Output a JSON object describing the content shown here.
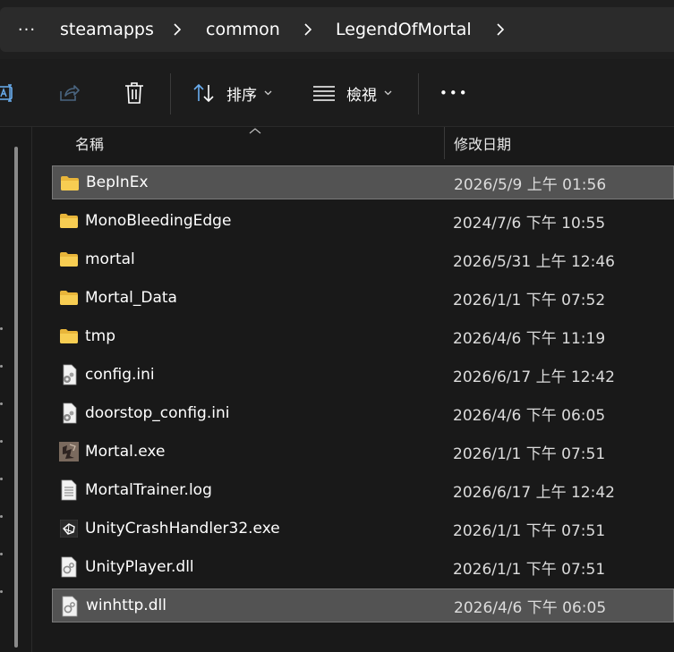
{
  "address": {
    "more_glyph": "···",
    "crumbs": [
      "steamapps",
      "common",
      "LegendOfMortal"
    ]
  },
  "toolbar": {
    "rename_icon": "rename-icon",
    "share_icon": "share-icon",
    "delete_icon": "trash-icon",
    "sort_label": "排序",
    "view_label": "檢視",
    "more_glyph": "•••"
  },
  "columns": {
    "name": "名稱",
    "date": "修改日期"
  },
  "files": [
    {
      "name": "BepInEx",
      "date": "2026/5/9 上午 01:56",
      "type": "folder",
      "selected": true
    },
    {
      "name": "MonoBleedingEdge",
      "date": "2024/7/6 下午 10:55",
      "type": "folder",
      "selected": false
    },
    {
      "name": "mortal",
      "date": "2026/5/31 上午 12:46",
      "type": "folder",
      "selected": false
    },
    {
      "name": "Mortal_Data",
      "date": "2026/1/1 下午 07:52",
      "type": "folder",
      "selected": false
    },
    {
      "name": "tmp",
      "date": "2026/4/6 下午 11:19",
      "type": "folder",
      "selected": false
    },
    {
      "name": "config.ini",
      "date": "2026/6/17 上午 12:42",
      "type": "config",
      "selected": false
    },
    {
      "name": "doorstop_config.ini",
      "date": "2026/4/6 下午 06:05",
      "type": "config",
      "selected": false
    },
    {
      "name": "Mortal.exe",
      "date": "2026/1/1 下午 07:51",
      "type": "app",
      "selected": false
    },
    {
      "name": "MortalTrainer.log",
      "date": "2026/6/17 上午 12:42",
      "type": "text",
      "selected": false
    },
    {
      "name": "UnityCrashHandler32.exe",
      "date": "2026/1/1 下午 07:51",
      "type": "unity",
      "selected": false
    },
    {
      "name": "UnityPlayer.dll",
      "date": "2026/1/1 下午 07:51",
      "type": "dll",
      "selected": false
    },
    {
      "name": "winhttp.dll",
      "date": "2026/4/6 下午 06:05",
      "type": "dll",
      "selected": true
    }
  ],
  "colors": {
    "folder": "#f4c84a",
    "selected_bg": "#535353",
    "background": "#191919"
  }
}
